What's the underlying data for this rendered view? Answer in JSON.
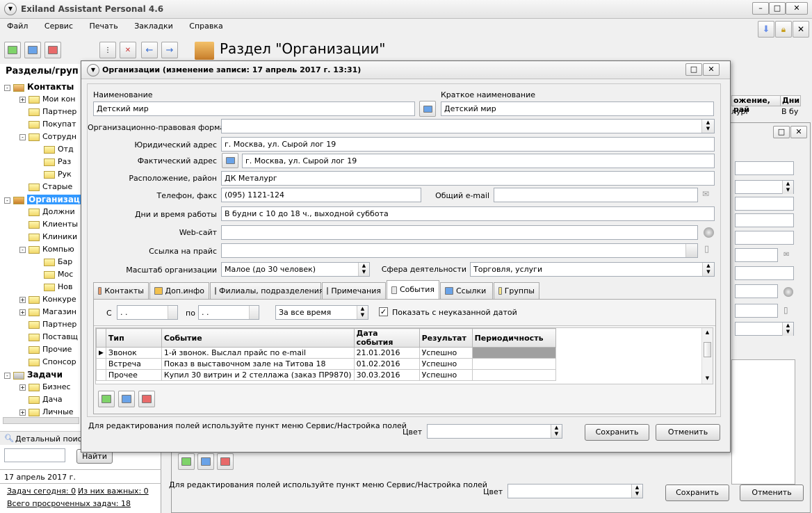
{
  "app": {
    "title": "Exiland Assistant Personal 4.6"
  },
  "menu": [
    "Файл",
    "Сервис",
    "Печать",
    "Закладки",
    "Справка"
  ],
  "sidebar": {
    "header": "Разделы/груп",
    "tree": [
      {
        "level": 0,
        "label": "Контакты",
        "bold": true,
        "exp": "-"
      },
      {
        "level": 1,
        "label": "Мои кон",
        "exp": "+"
      },
      {
        "level": 1,
        "label": "Партнер"
      },
      {
        "level": 1,
        "label": "Покупат"
      },
      {
        "level": 1,
        "label": "Сотрудн",
        "exp": "-"
      },
      {
        "level": 2,
        "label": "Отд"
      },
      {
        "level": 2,
        "label": "Раз"
      },
      {
        "level": 2,
        "label": "Рук"
      },
      {
        "level": 1,
        "label": "Старые"
      },
      {
        "level": 0,
        "label": "Организац",
        "bold": true,
        "exp": "-",
        "selected": true
      },
      {
        "level": 1,
        "label": "Должни"
      },
      {
        "level": 1,
        "label": "Клиенты"
      },
      {
        "level": 1,
        "label": "Клиники"
      },
      {
        "level": 1,
        "label": "Компью",
        "exp": "-"
      },
      {
        "level": 2,
        "label": "Бар"
      },
      {
        "level": 2,
        "label": "Мос"
      },
      {
        "level": 2,
        "label": "Нов"
      },
      {
        "level": 1,
        "label": "Конкуре",
        "exp": "+"
      },
      {
        "level": 1,
        "label": "Магазин",
        "exp": "+"
      },
      {
        "level": 1,
        "label": "Партнер"
      },
      {
        "level": 1,
        "label": "Поставщ"
      },
      {
        "level": 1,
        "label": "Прочие"
      },
      {
        "level": 1,
        "label": "Спонсор"
      },
      {
        "level": 0,
        "label": "Задачи",
        "bold": true,
        "exp": "-"
      },
      {
        "level": 1,
        "label": "Бизнес",
        "exp": "+"
      },
      {
        "level": 1,
        "label": "Дача"
      },
      {
        "level": 1,
        "label": "Личные",
        "exp": "+"
      }
    ],
    "search_label": "Детальный поиск",
    "find_button": "Найти",
    "date": "17 апрель 2017 г.",
    "tasks_today": "Задач сегодня: 0",
    "important": "Из них важных: 0",
    "overdue": "Всего просроченных задач: 18"
  },
  "section": {
    "title": "Раздел \"Организации\""
  },
  "background": {
    "col1": "ожение, рай",
    "col2": "Дни",
    "cell1": "лург",
    "cell2": "В бу",
    "hint": "Для редактирования полей используйте пункт меню Сервис/Настройка полей",
    "color_label": "Цвет",
    "save": "Сохранить",
    "cancel": "Отменить"
  },
  "dialog": {
    "title": "Организации  (изменение записи: 17 апрель 2017 г. 13:31)",
    "name_label": "Наименование",
    "name_value": "Детский мир",
    "short_label": "Краткое наименование",
    "short_value": "Детский мир",
    "form_label": "Организационно-правовая форма",
    "form_value": "",
    "legal_label": "Юридический адрес",
    "legal_value": "г. Москва, ул. Сырой лог 19",
    "actual_label": "Фактический адрес",
    "actual_value": "г. Москва, ул. Сырой лог 19",
    "location_label": "Расположение, район",
    "location_value": "ДК Металург",
    "phone_label": "Телефон, факс",
    "phone_value": "(095) 1121-124",
    "email_label": "Общий e-mail",
    "email_value": "",
    "hours_label": "Дни и время работы",
    "hours_value": "В будни с 10 до 18 ч., выходной суббота",
    "web_label": "Web-сайт",
    "web_value": "",
    "price_label": "Ссылка на прайс",
    "price_value": "",
    "scale_label": "Масштаб организации",
    "scale_value": "Малое (до 30 человек)",
    "sphere_label": "Сфера деятельности",
    "sphere_value": "Торговля, услуги",
    "tabs": [
      {
        "label": "Контакты",
        "color": "#e89a6a"
      },
      {
        "label": "Доп.инфо",
        "color": "#f2c14e"
      },
      {
        "label": "Филиалы, подразделения",
        "color": "#6a8fe8"
      },
      {
        "label": "Примечания",
        "color": "#8fb3e8"
      },
      {
        "label": "События",
        "color": "#e8e8e8",
        "active": true
      },
      {
        "label": "Ссылки",
        "color": "#6aa3e8"
      },
      {
        "label": "Группы",
        "color": "#f6e58d"
      }
    ],
    "filter": {
      "from_label": "С",
      "from_value": " .  .",
      "to_label": "по",
      "to_value": " .  .",
      "period_value": "За все время",
      "show_undated": "Показать с неуказанной датой"
    },
    "events_headers": [
      "Тип",
      "Событие",
      "Дата события",
      "Результат",
      "Периодичность"
    ],
    "events": [
      [
        "Звонок",
        "1-й звонок. Выслал прайс по e-mail",
        "21.01.2016",
        "Успешно",
        ""
      ],
      [
        "Встреча",
        "Показ в выставочном зале на Титова 18",
        "01.02.2016",
        "Успешно",
        ""
      ],
      [
        "Прочее",
        "Купил 30 витрин и 2 стеллажа (заказ ПР9870)",
        "30.03.2016",
        "Успешно",
        ""
      ]
    ],
    "hint": "Для редактирования полей используйте пункт меню Сервис/Настройка полей",
    "color_label": "Цвет",
    "save": "Сохранить",
    "cancel": "Отменить"
  }
}
